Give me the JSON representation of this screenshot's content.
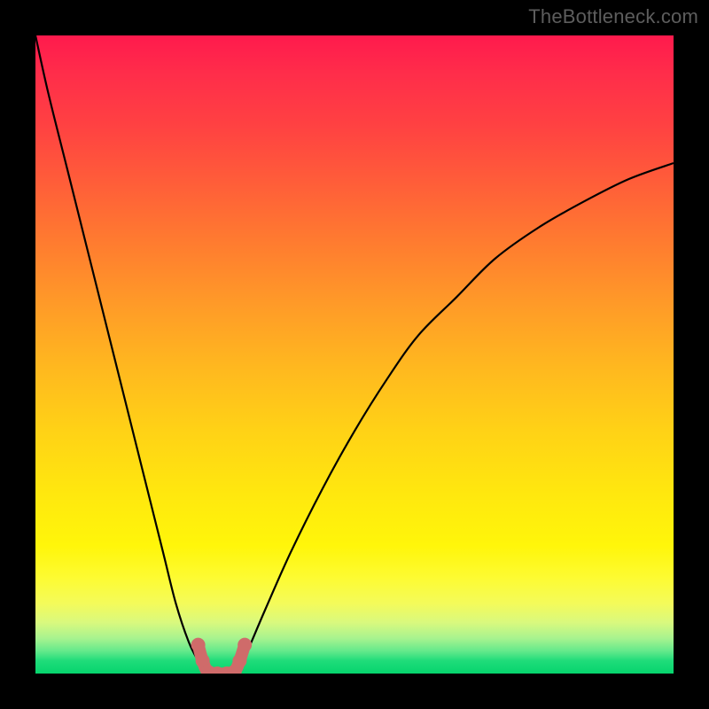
{
  "watermark": "TheBottleneck.com",
  "chart_data": {
    "type": "line",
    "title": "",
    "xlabel": "",
    "ylabel": "",
    "xlim": [
      0,
      100
    ],
    "ylim": [
      0,
      100
    ],
    "grid": false,
    "legend": false,
    "background_gradient": [
      "#ff1a4d",
      "#ff7a30",
      "#ffe80e",
      "#06d46d"
    ],
    "series": [
      {
        "name": "left-branch",
        "x": [
          0,
          2,
          5,
          8,
          11,
          14,
          17,
          20,
          22,
          24,
          25.5,
          26.5,
          27
        ],
        "y": [
          100,
          91,
          79,
          67,
          55,
          43,
          31,
          19,
          11,
          5,
          2,
          0.5,
          0
        ]
      },
      {
        "name": "right-branch",
        "x": [
          31.5,
          33,
          36,
          40,
          45,
          50,
          55,
          60,
          66,
          72,
          79,
          86,
          93,
          100
        ],
        "y": [
          0,
          3,
          10,
          19,
          29,
          38,
          46,
          53,
          59,
          65,
          70,
          74,
          77.5,
          80
        ]
      },
      {
        "name": "valley-floor",
        "x": [
          27,
          28.5,
          30,
          31.5
        ],
        "y": [
          0,
          0,
          0,
          0
        ]
      }
    ],
    "highlight": {
      "name": "valley-highlight",
      "x": [
        25.5,
        26.2,
        27,
        28.5,
        30,
        31.2,
        32,
        32.8
      ],
      "y": [
        4.5,
        2,
        0.3,
        0,
        0,
        0.3,
        2,
        4.5
      ],
      "color": "#cf6b6a"
    }
  }
}
